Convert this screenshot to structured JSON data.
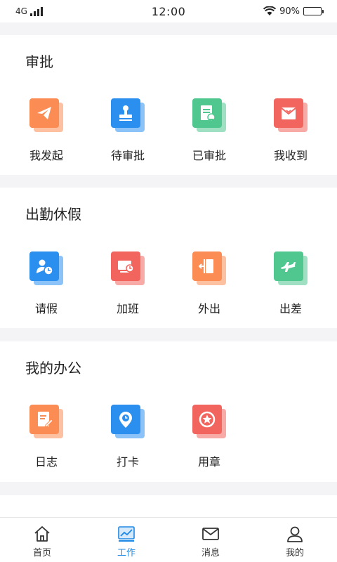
{
  "status_bar": {
    "network": "4G",
    "time": "12:00",
    "battery": "90%"
  },
  "sections": [
    {
      "title": "审批",
      "items": [
        {
          "label": "我发起",
          "icon": "paper-plane-icon",
          "color": "#fb8c53"
        },
        {
          "label": "待审批",
          "icon": "stamp-icon",
          "color": "#2b8ff0"
        },
        {
          "label": "已审批",
          "icon": "approved-document-icon",
          "color": "#4fc78e"
        },
        {
          "label": "我收到",
          "icon": "mail-icon",
          "color": "#f2645e"
        }
      ]
    },
    {
      "title": "出勤休假",
      "items": [
        {
          "label": "请假",
          "icon": "person-clock-icon",
          "color": "#2b8ff0"
        },
        {
          "label": "加班",
          "icon": "monitor-clock-icon",
          "color": "#f2645e"
        },
        {
          "label": "外出",
          "icon": "exit-door-icon",
          "color": "#fb8c53"
        },
        {
          "label": "出差",
          "icon": "airplane-icon",
          "color": "#4fc78e"
        }
      ]
    },
    {
      "title": "我的办公",
      "items": [
        {
          "label": "日志",
          "icon": "edit-document-icon",
          "color": "#fb8c53"
        },
        {
          "label": "打卡",
          "icon": "location-clock-icon",
          "color": "#2b8ff0"
        },
        {
          "label": "用章",
          "icon": "seal-star-icon",
          "color": "#f2645e"
        }
      ]
    }
  ],
  "tab_bar": [
    {
      "label": "首页",
      "icon": "home-icon",
      "active": false
    },
    {
      "label": "工作",
      "icon": "work-chart-icon",
      "active": true
    },
    {
      "label": "消息",
      "icon": "envelope-icon",
      "active": false
    },
    {
      "label": "我的",
      "icon": "user-icon",
      "active": false
    }
  ],
  "colors": {
    "accent": "#1e88e5",
    "background": "#f4f4f6",
    "card": "#ffffff"
  }
}
